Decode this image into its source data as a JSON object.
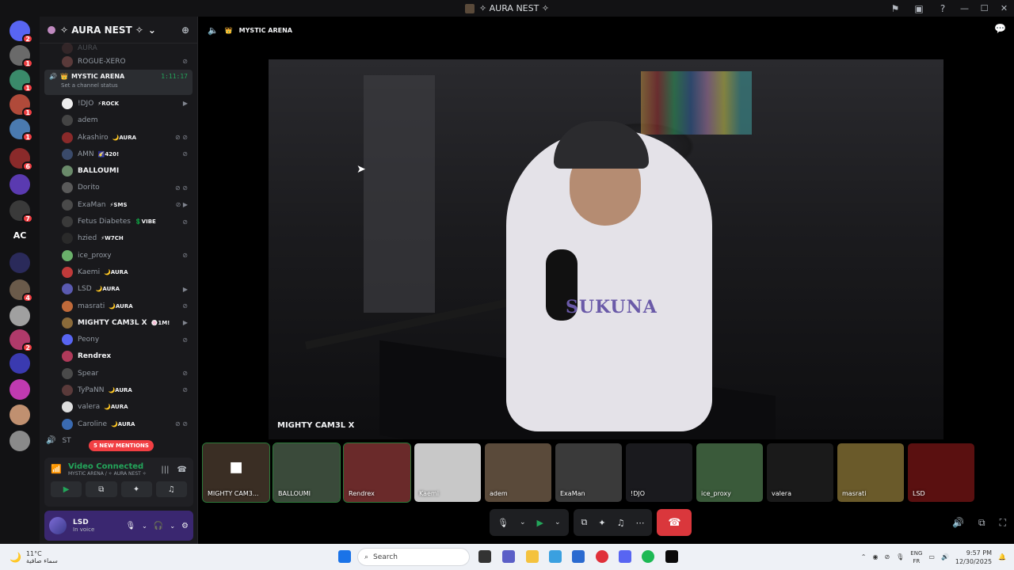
{
  "window": {
    "title": "✧ AURA NEST ✧"
  },
  "rail": {
    "servers": [
      {
        "icon": "discord-icon",
        "badge": "2",
        "color": "#5865f2"
      },
      {
        "icon": "server-avatar",
        "badge": "1",
        "color": "#6a6a6a"
      },
      {
        "icon": "server-avatar",
        "badge": "1",
        "color": "#3a8a6a"
      },
      {
        "icon": "server-avatar",
        "badge": "1",
        "color": "#b04a3a"
      },
      {
        "icon": "server-avatar",
        "badge": "1",
        "color": "#4a7ab0"
      },
      {
        "icon": "server-avatar",
        "badge": "6",
        "color": "#8a2a2a"
      },
      {
        "icon": "server-avatar",
        "badge": "",
        "color": "#5a3ab0"
      },
      {
        "icon": "server-avatar",
        "badge": "7",
        "color": "#3a3a3a"
      },
      {
        "icon": "text-initials",
        "label": "AC",
        "badge": "",
        "color": "#121214"
      },
      {
        "icon": "folder-icon",
        "badge": "",
        "color": "#2a2a5a"
      },
      {
        "icon": "server-avatar",
        "badge": "4",
        "color": "#6a5a4a"
      },
      {
        "icon": "server-avatar",
        "badge": "",
        "color": "#a0a0a0"
      },
      {
        "icon": "server-avatar",
        "badge": "2",
        "color": "#b03a6a"
      },
      {
        "icon": "server-avatar",
        "badge": "",
        "color": "#3a3ab0"
      },
      {
        "icon": "server-avatar",
        "badge": "",
        "color": "#c03ab0"
      },
      {
        "icon": "server-avatar",
        "badge": "",
        "color": "#c09070"
      },
      {
        "icon": "server-avatar",
        "badge": "",
        "color": "#8a8a8a"
      }
    ]
  },
  "sidebar": {
    "server_name": "✧ AURA NEST ✧",
    "above": [
      {
        "name": "AURA",
        "faded": true
      },
      {
        "name": "ROGUE-XERO",
        "deaf": true
      }
    ],
    "channel": {
      "name": "MYSTIC ARENA",
      "time": "1:11:17",
      "status": "Set a channel status"
    },
    "members": [
      {
        "name": "!DJO",
        "tag": "⚡ROCK",
        "icons": "▶",
        "bright": false,
        "color": "#eee"
      },
      {
        "name": "adem",
        "tag": "",
        "icons": "",
        "bright": false,
        "color": "#444"
      },
      {
        "name": "Akashiro",
        "tag": "🌙AURA",
        "icons": "⊘ ⊘",
        "bright": false,
        "color": "#8a2a2a"
      },
      {
        "name": "AMN",
        "tag": "🌠420!",
        "icons": "⊘",
        "bright": false,
        "color": "#3a4a6a"
      },
      {
        "name": "BALLOUMI",
        "tag": "",
        "icons": "",
        "bright": true,
        "color": "#6a8a6a"
      },
      {
        "name": "Dorito",
        "tag": "",
        "icons": "⊘ ⊘",
        "bright": false,
        "color": "#5a5a5a"
      },
      {
        "name": "ExaMan",
        "tag": "⚡SMS",
        "icons": "⊘ ▶",
        "bright": false,
        "color": "#4a4a4a"
      },
      {
        "name": "Fetus Diabetes",
        "tag": "💲VIBE",
        "icons": "⊘",
        "bright": false,
        "color": "#3a3a3a"
      },
      {
        "name": "hzied",
        "tag": "⚡W7CH",
        "icons": "",
        "bright": false,
        "color": "#2a2a2a"
      },
      {
        "name": "ice_proxy",
        "tag": "",
        "icons": "⊘",
        "bright": false,
        "color": "#6ab06a"
      },
      {
        "name": "Kaemi",
        "tag": "🌙AURA",
        "icons": "",
        "bright": false,
        "color": "#c03a3a"
      },
      {
        "name": "LSD",
        "tag": "🌙AURA",
        "icons": "▶",
        "bright": false,
        "color": "#5a5ab0"
      },
      {
        "name": "masrati",
        "tag": "🌙AURA",
        "icons": "⊘",
        "bright": false,
        "color": "#c06a3a"
      },
      {
        "name": "MIGHTY CAM3L X",
        "tag": "🍥1М!",
        "icons": "▶",
        "bright": true,
        "color": "#8a6a3a"
      },
      {
        "name": "Peony",
        "tag": "",
        "icons": "⊘",
        "bright": false,
        "color": "#5865f2"
      },
      {
        "name": "Rendrex",
        "tag": "",
        "icons": "",
        "bright": true,
        "color": "#b03a5a"
      },
      {
        "name": "Spear",
        "tag": "",
        "icons": "⊘",
        "bright": false,
        "color": "#4a4a4a"
      },
      {
        "name": "TyPaNN",
        "tag": "🌙AURA",
        "icons": "⊘",
        "bright": false,
        "color": "#5a3a3a"
      },
      {
        "name": "valera",
        "tag": "🌙AURA",
        "icons": "",
        "bright": false,
        "color": "#dedede"
      },
      {
        "name": "Caroline",
        "tag": "🌙AURA",
        "icons": "⊘ ⊘",
        "bright": false,
        "color": "#3a6ab0"
      }
    ],
    "below_partial": "ST",
    "mentions": "5 NEW MENTIONS",
    "voice": {
      "status": "Video Connected",
      "location": "MYSTIC ARENA / ✧ AURA NEST ✧"
    },
    "user": {
      "name": "LSD",
      "status": "In voice"
    }
  },
  "main": {
    "channel": "MYSTIC ARENA",
    "focused_label": "MIGHTY CAM3L X",
    "tiles": [
      {
        "label": "MIGHTY CAM3...",
        "icon": "video-camera-icon",
        "color": "#3a2e24"
      },
      {
        "label": "BALLOUMI",
        "icon": "",
        "color": "#3a4a3a"
      },
      {
        "label": "Rendrex",
        "icon": "",
        "color": "#6a2a2a"
      },
      {
        "label": "Kaemi",
        "icon": "",
        "color": "#c8c8c8"
      },
      {
        "label": "adem",
        "icon": "",
        "color": "#5a4a3a"
      },
      {
        "label": "ExaMan",
        "icon": "",
        "color": "#3a3a3a"
      },
      {
        "label": "!DJO",
        "icon": "",
        "color": "#1a1a1e"
      },
      {
        "label": "ice_proxy",
        "icon": "",
        "color": "#3a5a3a"
      },
      {
        "label": "valera",
        "icon": "",
        "color": "#1a1a1a"
      },
      {
        "label": "masrati",
        "icon": "",
        "color": "#6a5a2a"
      },
      {
        "label": "LSD",
        "icon": "",
        "color": "#5a1010"
      }
    ],
    "shirt_text": "SUKUNA"
  },
  "taskbar": {
    "weather_temp": "11°C",
    "weather_desc": "سماء صافية",
    "search_placeholder": "Search",
    "lang_top": "ENG",
    "lang_bottom": "FR",
    "time": "9:57 PM",
    "date": "12/30/2025"
  }
}
